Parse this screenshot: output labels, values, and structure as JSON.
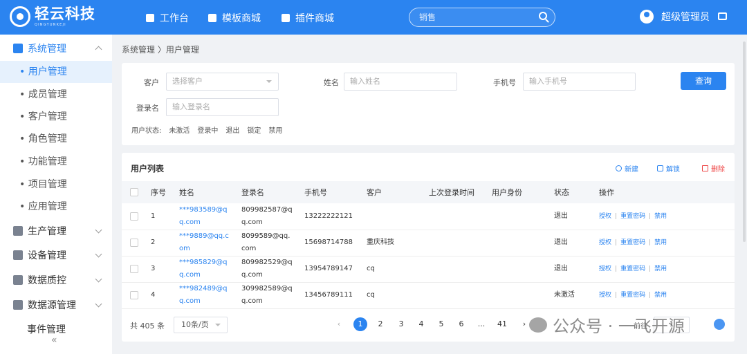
{
  "topbar": {
    "logo_text": "轻云科技",
    "logo_sub": "QINGYUNKEJI",
    "nav": [
      "工作台",
      "模板商城",
      "插件商城"
    ],
    "search_placeholder": "销售",
    "user_name": "超级管理员"
  },
  "sidebar": {
    "system": "系统管理",
    "sub": [
      "• 用户管理",
      "• 成员管理",
      "• 客户管理",
      "• 角色管理",
      "• 功能管理",
      "• 项目管理",
      "• 应用管理"
    ],
    "groups": [
      "生产管理",
      "设备管理",
      "数据质控",
      "数据源管理"
    ],
    "event": "事件管理",
    "collapse": "«"
  },
  "breadcrumb": "系统管理 〉用户管理",
  "filters": {
    "customer_label": "客户",
    "customer_placeholder": "选择客户",
    "name_label": "姓名",
    "name_placeholder": "输入姓名",
    "phone_label": "手机号",
    "phone_placeholder": "输入手机号",
    "login_label": "登录名",
    "login_placeholder": "输入登录名",
    "query": "查询",
    "status_label": "用户状态:",
    "statuses": [
      "未激活",
      "登录中",
      "退出",
      "锁定",
      "禁用"
    ]
  },
  "list": {
    "title": "用户列表",
    "new": "新建",
    "unlock": "解锁",
    "delete": "删除",
    "headers": [
      "序号",
      "姓名",
      "登录名",
      "手机号",
      "客户",
      "上次登录时间",
      "用户身份",
      "状态",
      "操作"
    ],
    "rows": [
      {
        "no": "1",
        "name": "***983589@qq.com",
        "login": "809982587@qq.com",
        "phone": "13222222121",
        "customer": "",
        "last": "",
        "role": "",
        "status": "退出"
      },
      {
        "no": "2",
        "name": "***9889@qq.com",
        "login": "8099589@qq.com",
        "phone": "15698714788",
        "customer": "重庆科技",
        "last": "",
        "role": "",
        "status": "退出"
      },
      {
        "no": "3",
        "name": "***985829@qq.com",
        "login": "809982529@qq.com",
        "phone": "13954789147",
        "customer": "cq",
        "last": "",
        "role": "",
        "status": "退出"
      },
      {
        "no": "4",
        "name": "***982489@qq.com",
        "login": "309982589@qq.com",
        "phone": "13456789111",
        "customer": "cq",
        "last": "",
        "role": "",
        "status": "未激活"
      }
    ],
    "ops": [
      "授权",
      "重置密码",
      "禁用"
    ]
  },
  "pager": {
    "total": "共 405 条",
    "pagesize": "10条/页",
    "pages": [
      "1",
      "2",
      "3",
      "4",
      "5",
      "6",
      "...",
      "41"
    ],
    "current": "1",
    "goto": "前往",
    "goto_value": "1",
    "prev": "‹",
    "next": "›"
  },
  "watermark": "公众号 · 一飞开源"
}
